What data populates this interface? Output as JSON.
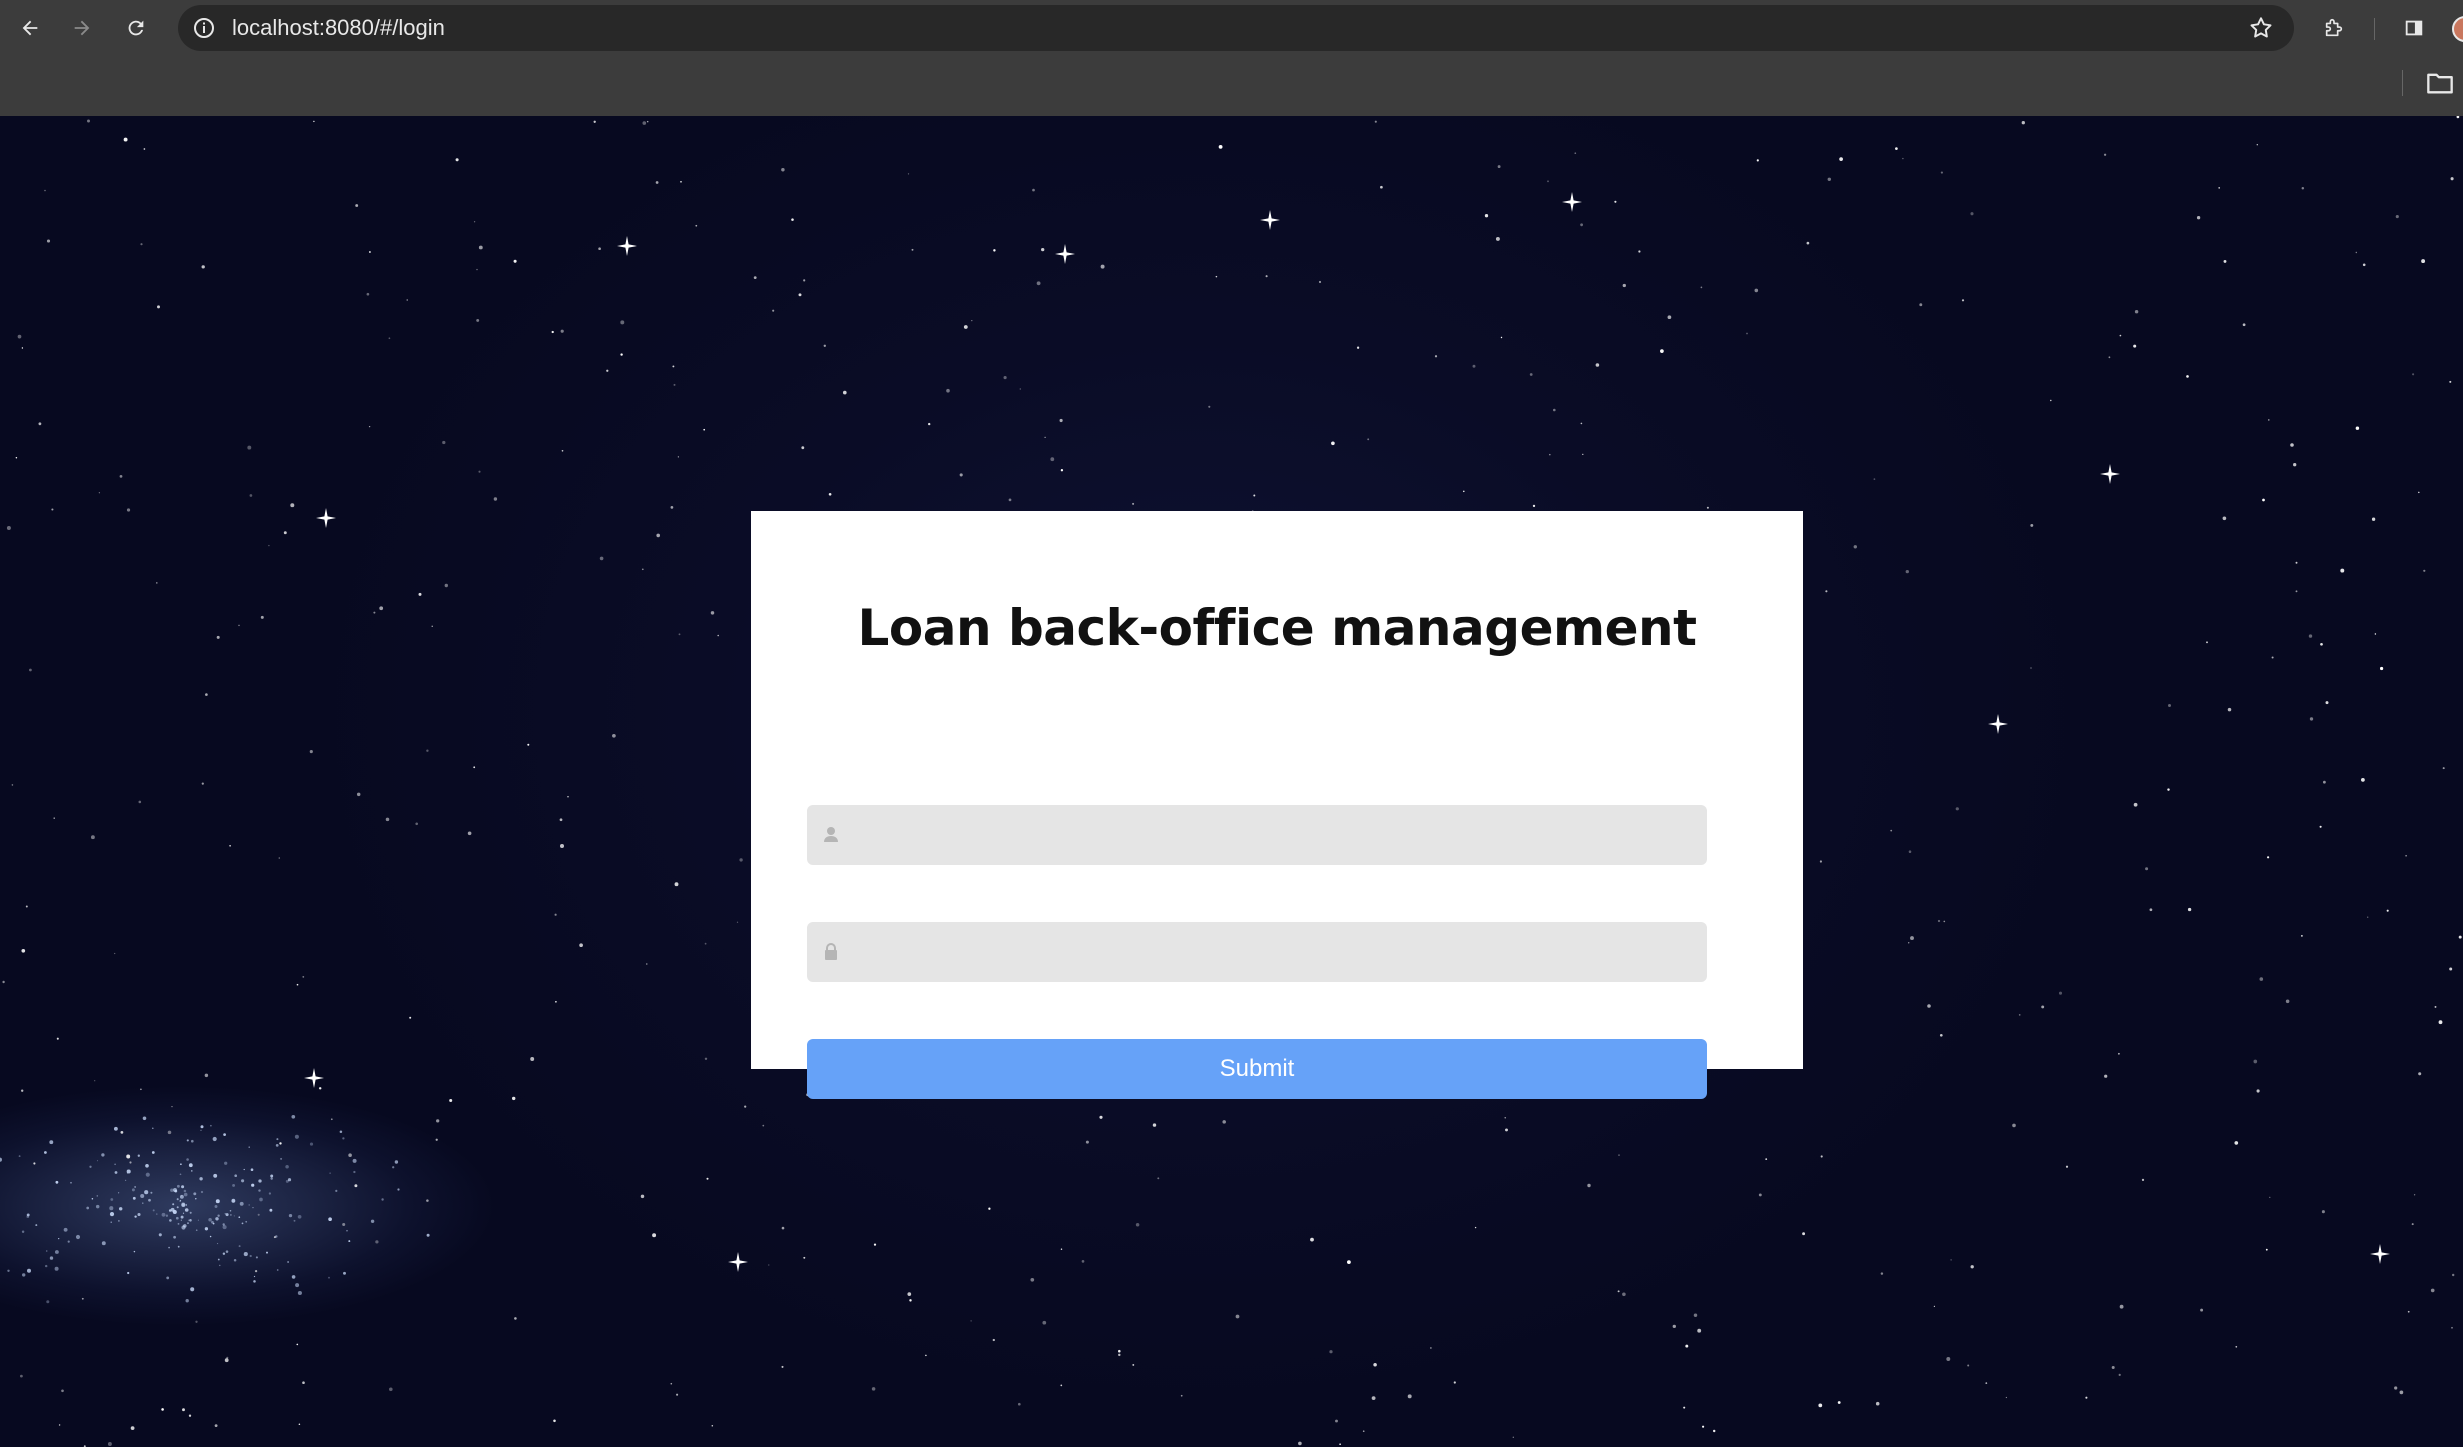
{
  "browser": {
    "url": "localhost:8080/#/login",
    "icons": {
      "back": "back-arrow-icon",
      "forward": "forward-arrow-icon",
      "reload": "reload-icon",
      "site_info": "info-icon",
      "bookmark": "star-icon",
      "extensions": "puzzle-icon",
      "side_panel": "side-panel-icon",
      "bookmarks_folder": "folder-icon"
    }
  },
  "login": {
    "title": "Loan back-office management",
    "username": {
      "value": "",
      "placeholder": "",
      "icon": "user-icon"
    },
    "password": {
      "value": "",
      "placeholder": "",
      "icon": "lock-icon"
    },
    "submit_label": "Submit"
  },
  "colors": {
    "chrome": "#3c3c3c",
    "background": "#0a0c24",
    "card": "#ffffff",
    "input": "#e5e5e5",
    "button": "#66a2f8"
  }
}
